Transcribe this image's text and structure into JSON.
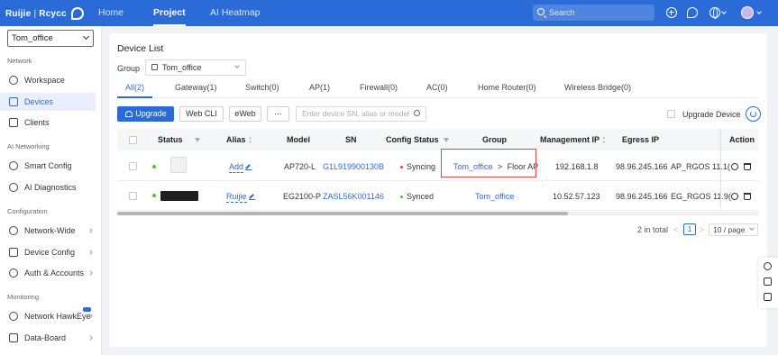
{
  "brand": {
    "name": "Ruijie",
    "separator": "|",
    "sub": "Rcycc"
  },
  "topnav": {
    "items": [
      "Home",
      "Project",
      "AI Heatmap"
    ],
    "active": "Project"
  },
  "search": {
    "placeholder": "Search"
  },
  "sidebar": {
    "site": "Tom_office",
    "sections": [
      {
        "label": "Network",
        "items": [
          {
            "label": "Workspace",
            "icon": "workspace-icon"
          },
          {
            "label": "Devices",
            "icon": "devices-icon",
            "active": true
          },
          {
            "label": "Clients",
            "icon": "clients-icon"
          }
        ]
      },
      {
        "label": "AI Networking",
        "items": [
          {
            "label": "Smart Config",
            "icon": "smart-config-icon"
          },
          {
            "label": "AI Diagnostics",
            "icon": "ai-diagnostics-icon"
          }
        ]
      },
      {
        "label": "Configuration",
        "items": [
          {
            "label": "Network-Wide",
            "icon": "network-wide-icon"
          },
          {
            "label": "Device Config",
            "icon": "device-config-icon"
          },
          {
            "label": "Auth & Accounts",
            "icon": "auth-icon"
          }
        ]
      },
      {
        "label": "Monitoring",
        "items": [
          {
            "label": "Network HawkEye",
            "icon": "hawkeye-icon"
          },
          {
            "label": "Data-Board",
            "icon": "data-board-icon"
          }
        ]
      }
    ]
  },
  "main": {
    "title": "Device List",
    "group_label": "Group",
    "group_value": "Tom_office",
    "tabs": [
      "All(2)",
      "Gateway(1)",
      "Switch(0)",
      "AP(1)",
      "Firewall(0)",
      "AC(0)",
      "Home Router(0)",
      "Wireless Bridge(0)"
    ],
    "toolbar": {
      "upgrade": "Upgrade",
      "webcli": "Web CLI",
      "eweb": "eWeb",
      "more": "···",
      "search_placeholder": "Enter device SN, alias or model",
      "upgrade_device": "Upgrade Device"
    },
    "columns": [
      "Status",
      "Alias",
      "Model",
      "SN",
      "Config Status",
      "Group",
      "Management IP",
      "Egress IP",
      "Action"
    ],
    "rows": [
      {
        "alias": "Add",
        "model": "AP720-L",
        "sn": "G1L919900130B",
        "config_status": "Syncing",
        "config_color": "#e64545",
        "group_root": "Tom_office",
        "group_sep": ">",
        "group_sub": "Floor AP",
        "mgmt_ip": "192.168.1.8",
        "egress_ip": "98.96.245.166",
        "software": "AP_RGOS 11.1("
      },
      {
        "alias": "Ruijie",
        "model": "EG2100-P",
        "sn": "ZASL56K001146",
        "config_status": "Synced",
        "config_color": "#52c41a",
        "group_root": "Tom_office",
        "mgmt_ip": "10.52.57.123",
        "egress_ip": "98.96.245.166",
        "software": "EG_RGOS 11.9("
      }
    ],
    "pagination": {
      "total": "2 in total",
      "prev": "<",
      "current": "1",
      "next": ">",
      "page_size": "10 / page"
    }
  },
  "colors": {
    "brand_blue": "#2a6bd8",
    "highlight_red": "#e64545",
    "online_green": "#52c41a"
  }
}
